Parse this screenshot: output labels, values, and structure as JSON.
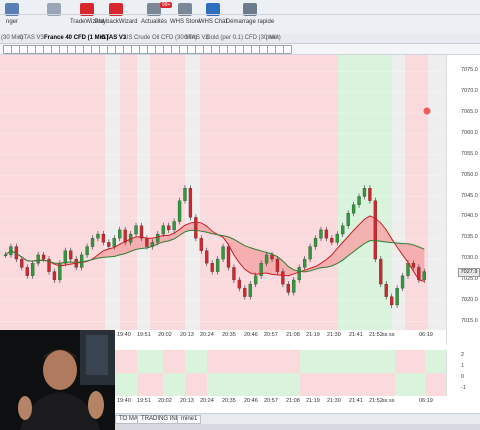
{
  "toolbar": {
    "items": [
      {
        "label": "nger",
        "icon": "manager-icon"
      },
      {
        "label": "",
        "icon": "grid-icon"
      },
      {
        "label": "TradeWizard",
        "icon": "wand-icon"
      },
      {
        "label": "PlaybackWizard",
        "icon": "playback-icon"
      },
      {
        "label": "Actualités",
        "icon": "news-icon",
        "badge": "99+"
      },
      {
        "label": "WHS Store",
        "icon": "store-icon"
      },
      {
        "label": "WHS Chat",
        "icon": "chat-icon"
      },
      {
        "label": "Démarrage rapide",
        "icon": "rocket-icon"
      }
    ]
  },
  "tabs": [
    {
      "label": "(30 Min)"
    },
    {
      "label": "GTAS V3"
    },
    {
      "label": "France 40 CFD (1 Min.)"
    },
    {
      "label": "GTAS V3"
    },
    {
      "label": "US Crude Oil CFD (30 Min)"
    },
    {
      "label": "GTAS V3"
    },
    {
      "label": "Gold (per 0.1) CFD (30 Min)"
    },
    {
      "label": "pivot"
    }
  ],
  "chart": {
    "price_label": "7027.9",
    "accent_red": "#d9262c",
    "bull_color": "#2e9a3c",
    "bear_color": "#d3262c",
    "bg_red": "#fadadd",
    "bg_green": "#daf3dd",
    "bg_grey": "#eeeeee"
  },
  "chart_data": {
    "type": "candlestick",
    "x_ticks": [
      "19:40",
      "19:51",
      "20:02",
      "20:13",
      "20:24",
      "20:35",
      "20:46",
      "20:57",
      "21:08",
      "21:19",
      "21:30",
      "21:41",
      "21:52",
      "ss ss",
      "06:19"
    ],
    "y_ticks": [
      7075.0,
      7070.0,
      7065.0,
      7060.0,
      7055.0,
      7050.0,
      7045.0,
      7040.0,
      7035.0,
      7030.0,
      7025.0,
      7020.0,
      7015.0
    ],
    "ylim": [
      7013,
      7077
    ]
  },
  "subchart": {
    "scale": [
      "2",
      "1",
      "0",
      "-1"
    ]
  },
  "bottom_tabs": [
    {
      "label": "TO MAX"
    },
    {
      "label": "TRADING INDICES"
    },
    {
      "label": "mine1"
    }
  ]
}
